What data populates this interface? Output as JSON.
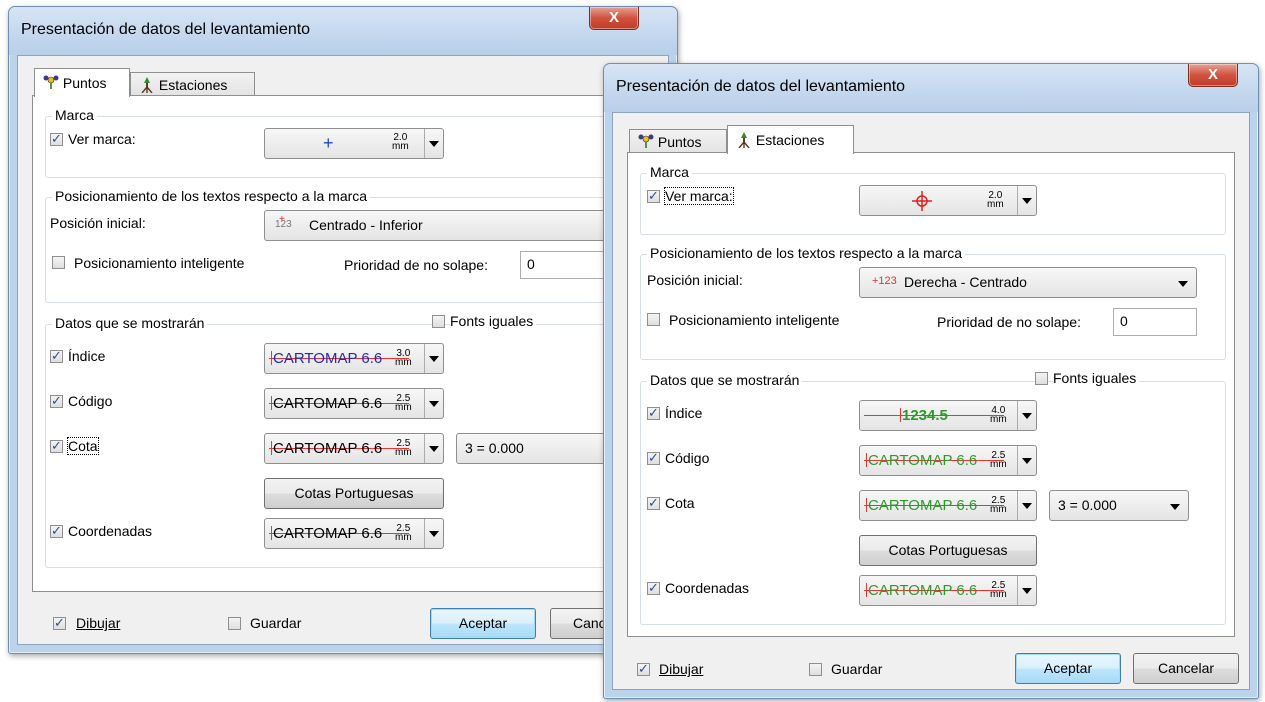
{
  "left_dialog": {
    "title": "Presentación de datos del levantamiento",
    "close_label": "X",
    "tabs": [
      {
        "label": "Puntos",
        "icon": "points-icon",
        "active": true
      },
      {
        "label": "Estaciones",
        "icon": "station-icon",
        "active": false
      }
    ],
    "marca": {
      "group_label": "Marca",
      "ver_marca_label": "Ver marca:",
      "ver_marca_checked": true,
      "marker_icon": "plus-marker-icon",
      "marker_color": "#2846c8",
      "size_value": "2.0",
      "size_unit": "mm"
    },
    "posicionamiento": {
      "group_label": "Posicionamiento de los textos respecto a la marca",
      "posicion_inicial_label": "Posición inicial:",
      "posicion_inicial_icon_text": "123",
      "posicion_inicial_value": "Centrado - Inferior",
      "inteligente_label": "Posicionamiento inteligente",
      "inteligente_checked": false,
      "prioridad_label": "Prioridad de no solape:",
      "prioridad_value": "0"
    },
    "datos": {
      "group_label": "Datos que se mostrarán",
      "fonts_iguales_label": "Fonts iguales",
      "fonts_iguales_checked": false,
      "rows": [
        {
          "label": "Índice",
          "checked": true,
          "sample": "CARTOMAP 6.6",
          "size": "3.0",
          "unit": "mm"
        },
        {
          "label": "Código",
          "checked": true,
          "sample": "CARTOMAP 6.6",
          "size": "2.5",
          "unit": "mm"
        },
        {
          "label": "Cota",
          "checked": true,
          "sample": "CARTOMAP 6.6",
          "size": "2.5",
          "unit": "mm",
          "extra_value": "3 = 0.000"
        },
        {
          "label": "Coordenadas",
          "checked": true,
          "sample": "CARTOMAP 6.6",
          "size": "2.5",
          "unit": "mm"
        }
      ],
      "cotas_button": "Cotas Portuguesas",
      "sample_color": "#1e2db4"
    },
    "footer": {
      "dibujar_label": "Dibujar",
      "dibujar_checked": true,
      "guardar_label": "Guardar",
      "guardar_checked": false,
      "aceptar_label": "Aceptar",
      "cancelar_label": "Canc"
    }
  },
  "right_dialog": {
    "title": "Presentación de datos del levantamiento",
    "close_label": "X",
    "tabs": [
      {
        "label": "Puntos",
        "icon": "points-icon",
        "active": false
      },
      {
        "label": "Estaciones",
        "icon": "station-icon",
        "active": true
      }
    ],
    "marca": {
      "group_label": "Marca",
      "ver_marca_label": "Ver marca:",
      "ver_marca_checked": true,
      "marker_icon": "crosshair-marker-icon",
      "marker_color": "#e22020",
      "size_value": "2.0",
      "size_unit": "mm"
    },
    "posicionamiento": {
      "group_label": "Posicionamiento de los textos respecto a la marca",
      "posicion_inicial_label": "Posición inicial:",
      "posicion_inicial_icon_text": "+123",
      "posicion_inicial_value": "Derecha - Centrado",
      "inteligente_label": "Posicionamiento inteligente",
      "inteligente_checked": false,
      "prioridad_label": "Prioridad de no solape:",
      "prioridad_value": "0"
    },
    "datos": {
      "group_label": "Datos que se mostrarán",
      "fonts_iguales_label": "Fonts iguales",
      "fonts_iguales_checked": false,
      "rows": [
        {
          "label": "Índice",
          "checked": true,
          "sample": "1234.5",
          "size": "4.0",
          "unit": "mm"
        },
        {
          "label": "Código",
          "checked": true,
          "sample": "CARTOMAP 6.6",
          "size": "2.5",
          "unit": "mm"
        },
        {
          "label": "Cota",
          "checked": true,
          "sample": "CARTOMAP 6.6",
          "size": "2.5",
          "unit": "mm",
          "extra_value": "3 = 0.000"
        },
        {
          "label": "Coordenadas",
          "checked": true,
          "sample": "CARTOMAP 6.6",
          "size": "2.5",
          "unit": "mm"
        }
      ],
      "cotas_button": "Cotas Portuguesas",
      "sample_color": "#2e9a2e"
    },
    "footer": {
      "dibujar_label": "Dibujar",
      "dibujar_checked": true,
      "guardar_label": "Guardar",
      "guardar_checked": false,
      "aceptar_label": "Aceptar",
      "cancelar_label": "Cancelar"
    }
  }
}
